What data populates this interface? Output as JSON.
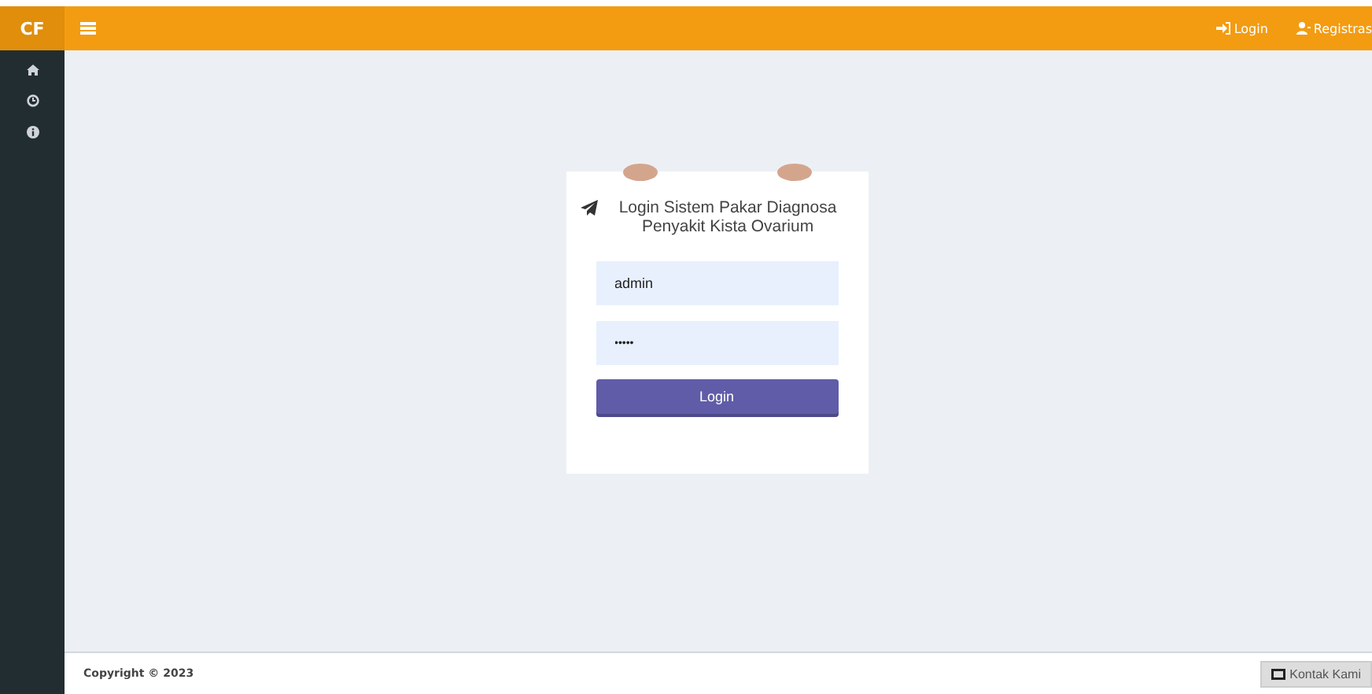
{
  "brand": "CF",
  "nav_links": [
    {
      "label": "Login",
      "kind": "login"
    },
    {
      "label": "Registras",
      "kind": "register"
    }
  ],
  "sidebar": {
    "items": [
      {
        "kind": "home"
      },
      {
        "kind": "clock"
      },
      {
        "kind": "info"
      }
    ]
  },
  "login_card": {
    "title": "Login Sistem Pakar Diagnosa Penyakit Kista Ovarium",
    "username": {
      "value": "admin"
    },
    "password": {
      "value": "•••••"
    },
    "button": "Login"
  },
  "footer": {
    "copyright": "Copyright © 2023",
    "contact_button": "Kontak Kami"
  }
}
